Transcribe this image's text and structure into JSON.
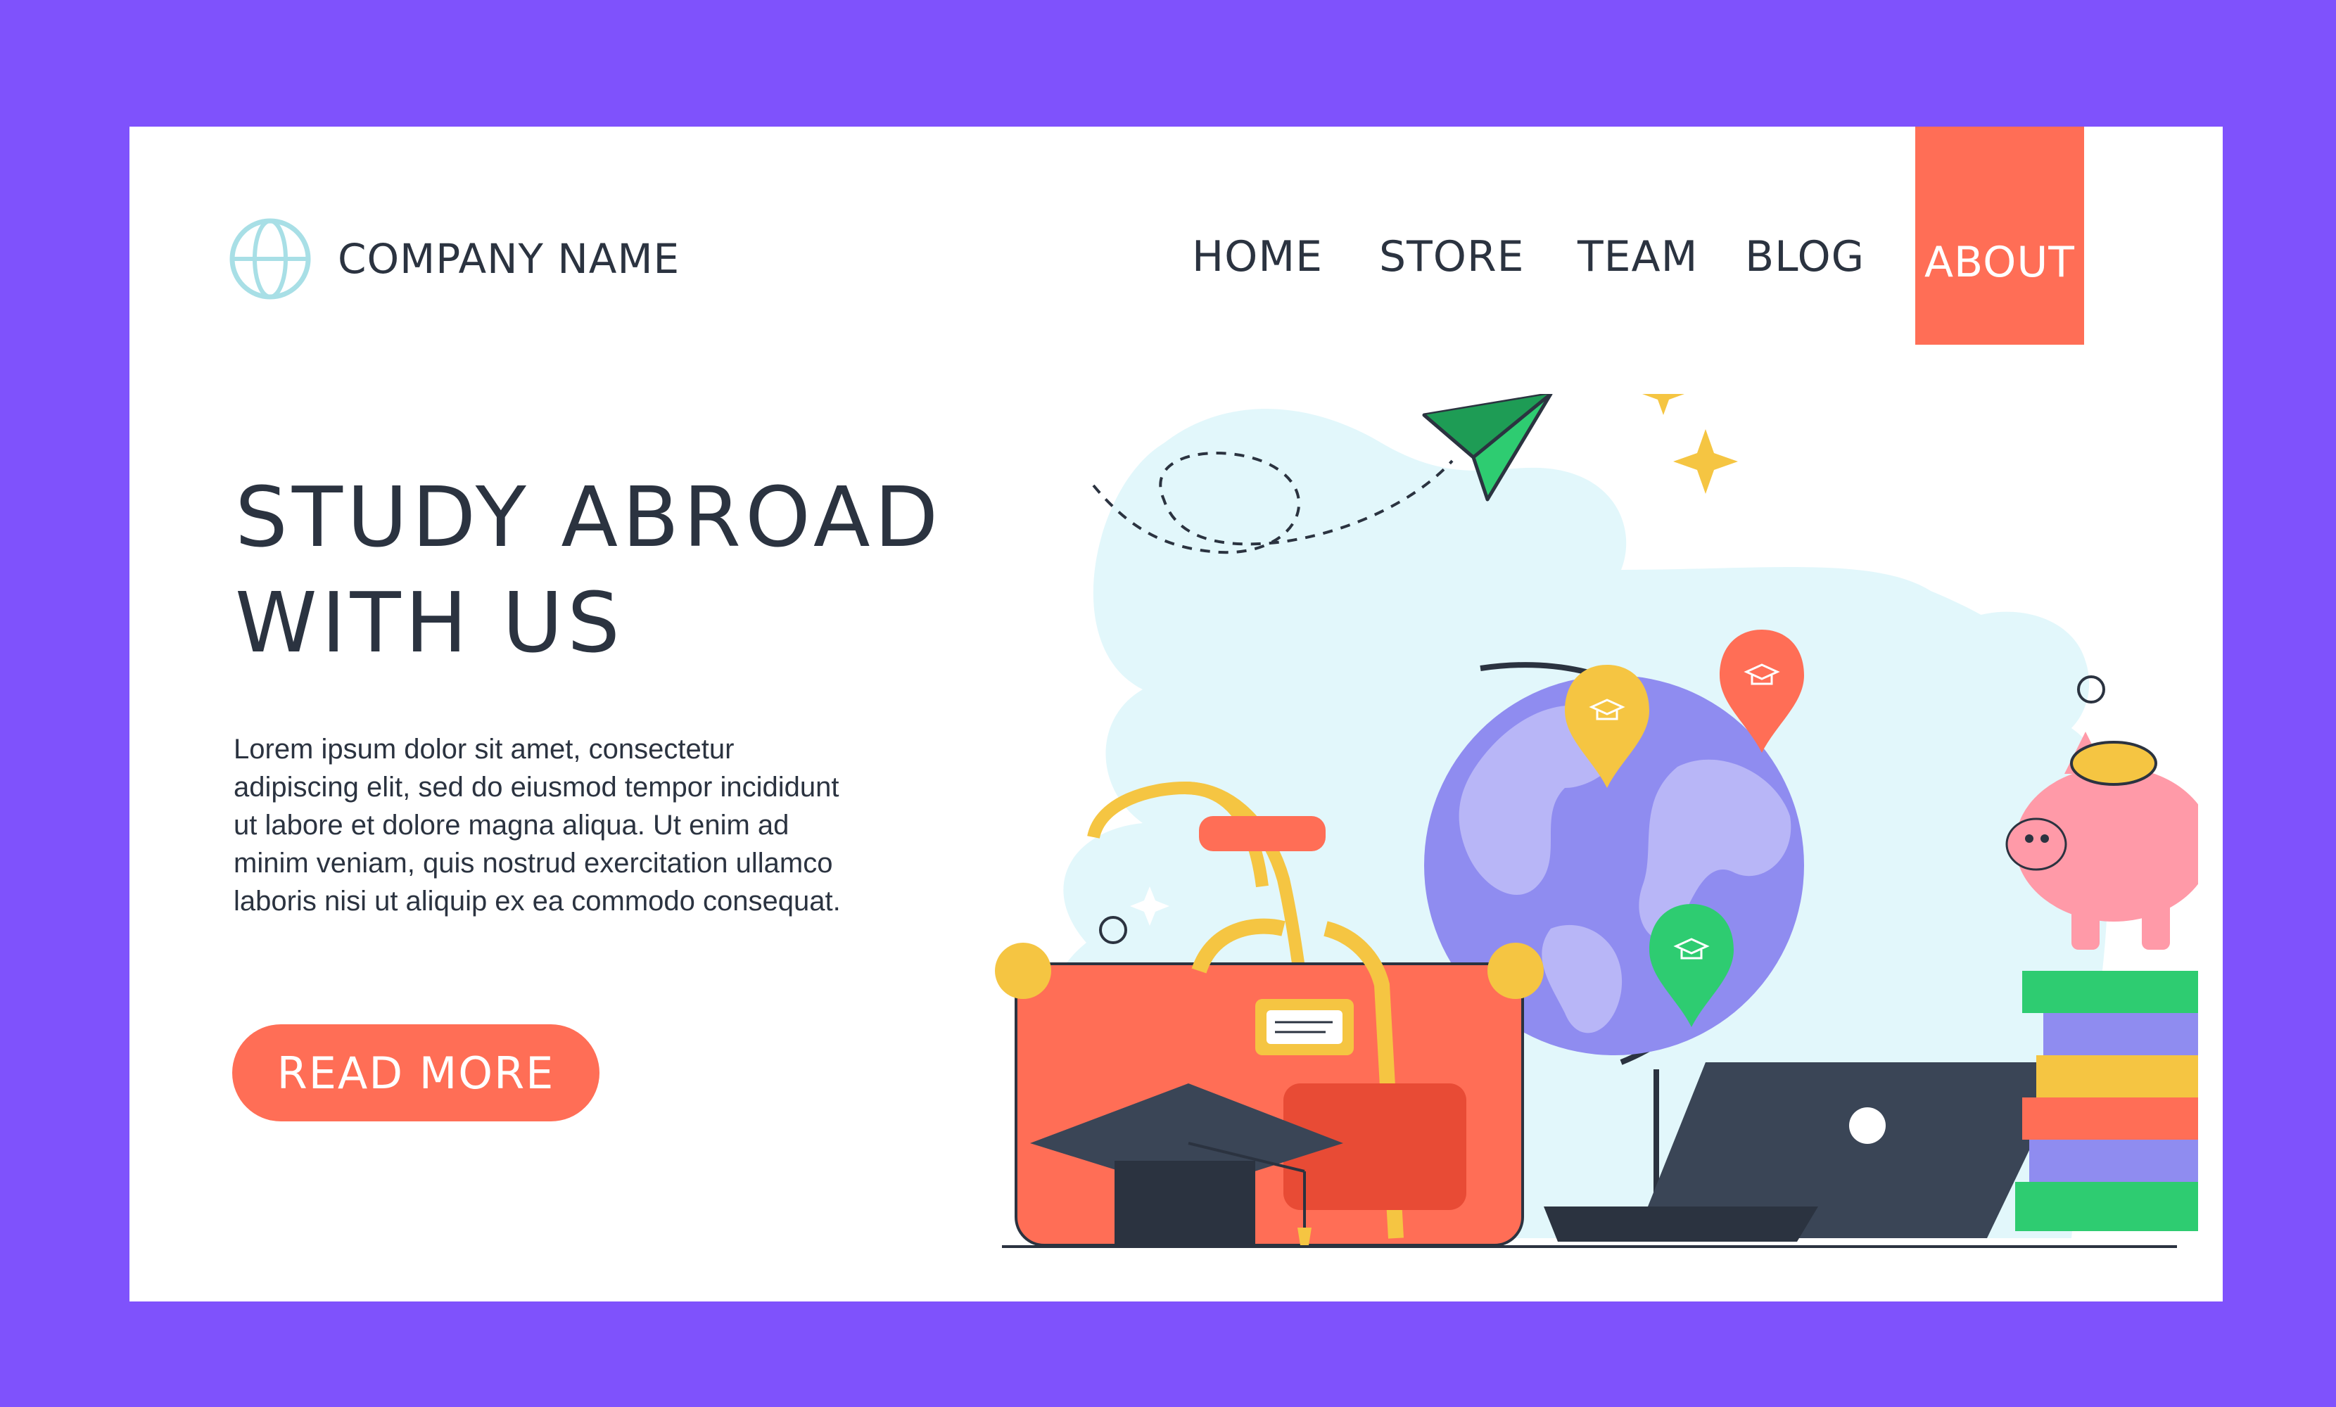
{
  "brand": {
    "company_name": "COMPANY NAME",
    "icon": "globe-icon"
  },
  "nav": {
    "items": [
      {
        "label": "HOME"
      },
      {
        "label": "STORE"
      },
      {
        "label": "TEAM"
      },
      {
        "label": "BLOG"
      },
      {
        "label": "ABOUT",
        "active": true
      }
    ]
  },
  "hero": {
    "title_line1": "STUDY ABROAD",
    "title_line2": "WITH US",
    "body": "Lorem ipsum dolor sit amet, consectetur adipiscing elit, sed do eiusmod tempor incididunt ut labore et dolore magna aliqua. Ut enim ad minim veniam, quis nostrud exercitation ullamco laboris nisi ut aliquip ex ea commodo consequat.",
    "cta_label": "READ MORE"
  },
  "illustration": {
    "elements": [
      "paper-plane-icon",
      "globe-icon",
      "location-pin-icon",
      "graduation-cap-icon",
      "suitcase-icon",
      "laptop-icon",
      "piggy-bank-icon",
      "books-icon",
      "coin-icon",
      "sparkle-icon"
    ]
  },
  "colors": {
    "background": "#7f52fc",
    "card": "#ffffff",
    "accent": "#ff6e56",
    "text": "#2b3340",
    "globe": "#8f8cf0",
    "blob": "#e2f7fb"
  }
}
